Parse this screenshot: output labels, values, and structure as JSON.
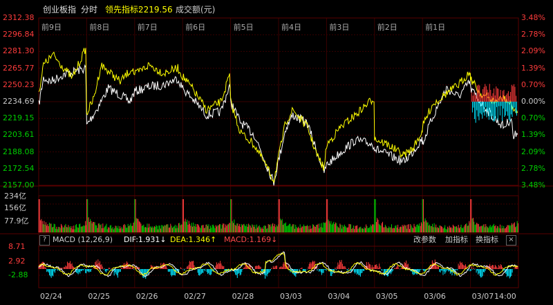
{
  "header": {
    "index_name": "创业板指",
    "mode": "分时",
    "leader_label": "领先指标:",
    "leader_value": "2219.56",
    "volume_label": "成交额(元)"
  },
  "price_axis": {
    "left": [
      "2312.38",
      "2296.84",
      "2281.30",
      "2265.77",
      "2250.23",
      "2234.69",
      "2219.15",
      "2203.61",
      "2188.08",
      "2172.54",
      "2157.00"
    ],
    "right": [
      "3.48%",
      "2.78%",
      "2.09%",
      "1.39%",
      "0.70%",
      "0.00%",
      "0.70%",
      "1.39%",
      "2.09%",
      "2.78%",
      "3.48%"
    ]
  },
  "day_labels": [
    "前9日",
    "前8日",
    "前7日",
    "前6日",
    "前5日",
    "前4日",
    "前3日",
    "前2日",
    "前1日"
  ],
  "volume_axis": [
    "234亿",
    "156亿",
    "77.9亿"
  ],
  "macd": {
    "title": "MACD (12,26,9)",
    "help": "?",
    "dif": "DIF:1.931↓",
    "dea": "DEA:1.346↑",
    "macd": "MACD:1.169↓",
    "btn_params": "改参数",
    "btn_add": "加指标",
    "btn_switch": "换指标",
    "btn_close": "×",
    "axis": [
      "8.71",
      "2.92",
      "-2.88"
    ]
  },
  "dates": [
    "02/24",
    "02/25",
    "02/26",
    "02/27",
    "02/28",
    "03/03",
    "03/04",
    "03/05",
    "03/06",
    "03/07",
    "14:00"
  ],
  "colors": {
    "up": "#ff3c3c",
    "down": "#00d000",
    "yellow": "#ffff00",
    "white": "#ffffff",
    "cyan": "#00e5ff",
    "grid": "#3a0000",
    "axis_right_down": "#00d000"
  }
}
